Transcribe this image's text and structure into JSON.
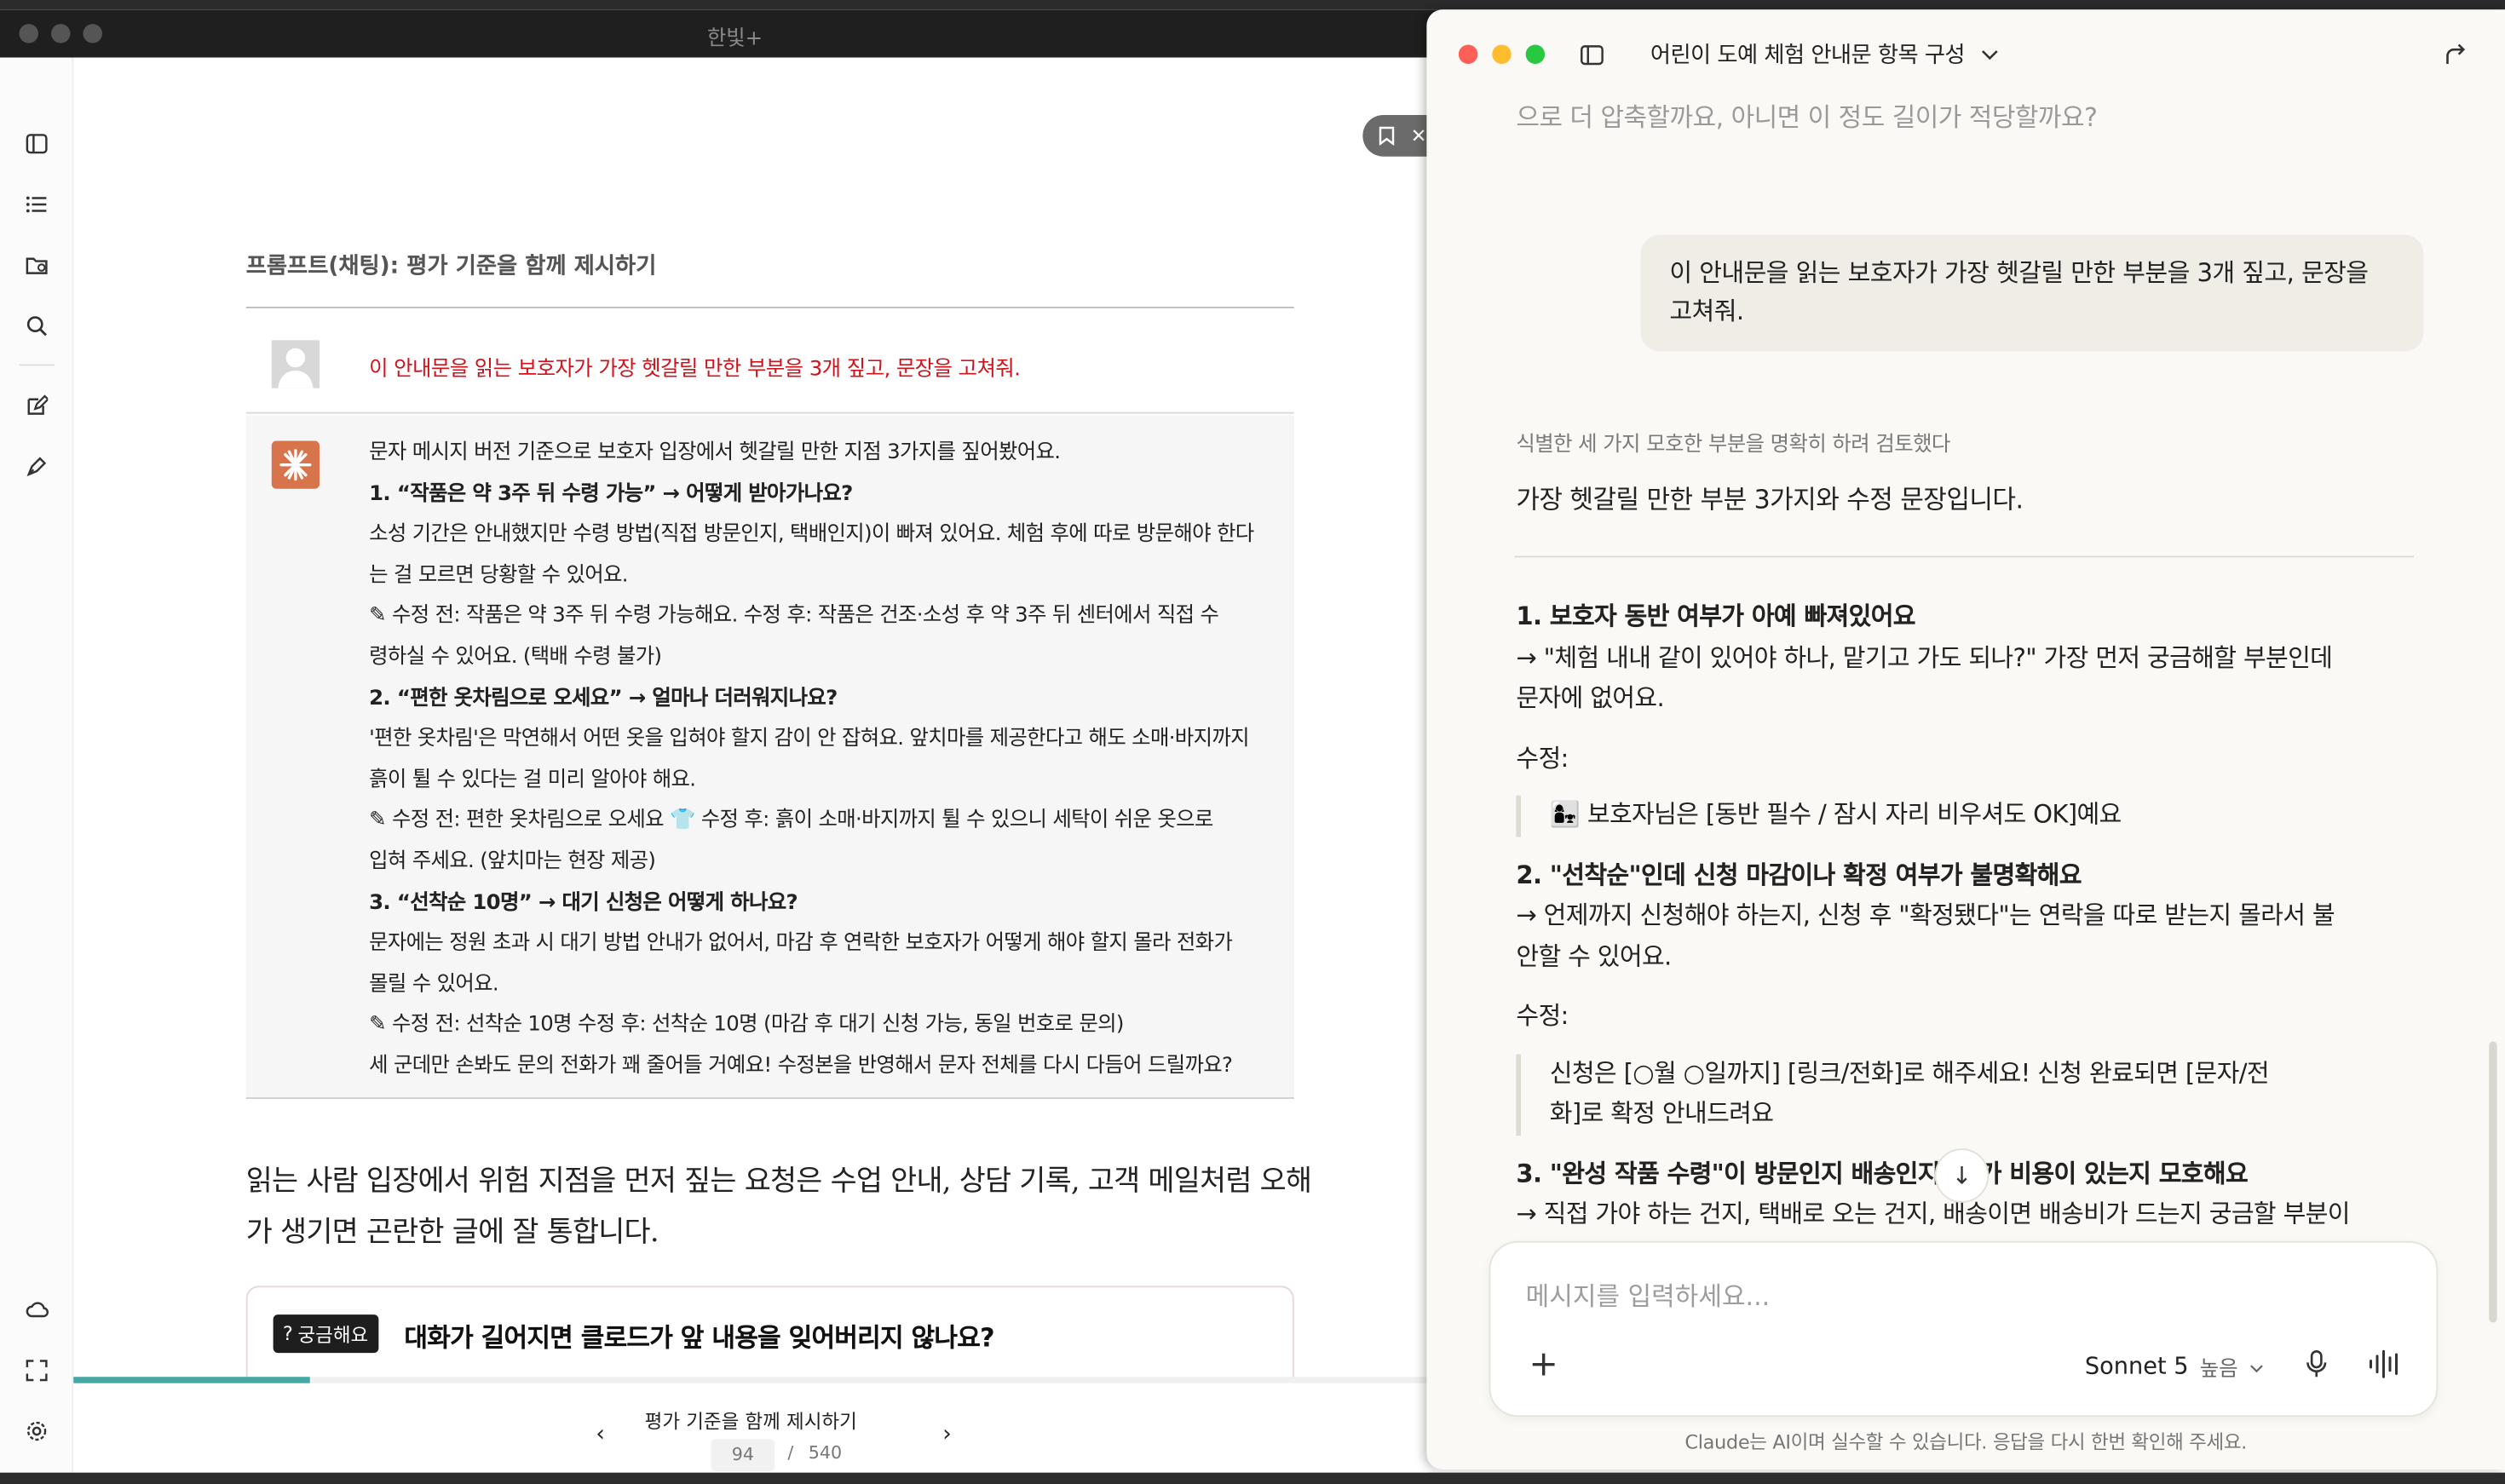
{
  "reader": {
    "app_title": "한빛+",
    "section_label": "프롬프트(채팅): 평가 기준을 함께 제시하기",
    "prompt_text": "이 안내문을 읽는 보호자가 가장 헷갈릴 만한 부분을 3개 짚고, 문장을 고쳐줘.",
    "answer_lines": [
      "문자 메시지 버전 기준으로 보호자 입장에서 헷갈릴 만한 지점 3가지를 짚어봤어요.",
      "1. “작품은 약 3주 뒤 수령 가능” → 어떻게 받아가나요?",
      "소성 기간은 안내했지만 수령 방법(직접 방문인지, 택배인지)이 빠져 있어요. 체험 후에 따로 방문해야 한다",
      "는 걸 모르면 당황할 수 있어요.",
      "✎ 수정 전: 작품은 약 3주 뒤 수령 가능해요. 수정 후: 작품은 건조·소성 후 약 3주 뒤 센터에서 직접 수",
      "령하실 수 있어요. (택배 수령 불가)",
      "2. “편한 옷차림으로 오세요” → 얼마나 더러워지나요?",
      "'편한 옷차림'은 막연해서 어떤 옷을 입혀야 할지 감이 안 잡혀요. 앞치마를 제공한다고 해도 소매·바지까지",
      "흙이 튈 수 있다는 걸 미리 알아야 해요.",
      "✎ 수정 전: 편한 옷차림으로 오세요 👕 수정 후: 흙이 소매·바지까지 튈 수 있으니 세탁이 쉬운 옷으로",
      "입혀 주세요. (앞치마는 현장 제공)",
      "3. “선착순 10명” → 대기 신청은 어떻게 하나요?",
      "문자에는 정원 초과 시 대기 방법 안내가 없어서, 마감 후 연락한 보호자가 어떻게 해야 할지 몰라 전화가",
      "몰릴 수 있어요.",
      "✎ 수정 전: 선착순 10명 수정 후: 선착순 10명 (마감 후 대기 신청 가능, 동일 번호로 문의)",
      "세 군데만 손봐도 문의 전화가 꽤 줄어들 거예요! 수정본을 반영해서 문자 전체를 다시 다듬어 드릴까요?"
    ],
    "body_lines": [
      "읽는 사람 입장에서 위험 지점을 먼저 짚는 요청은 수업 안내, 상담 기록, 고객 메일처럼 오해",
      "가 생기면 곤란한 글에 잘 통합니다."
    ],
    "faq_badge": "궁금해요",
    "faq_title": "대화가 길어지면 클로드가 앞 내용을 잊어버리지 않나요?",
    "chapter_title": "평가 기준을 함께 제시하기",
    "current_page": "94",
    "page_sep": "/",
    "total_pages": "540",
    "reading_progress": 0.174
  },
  "claude": {
    "conversation_title": "어린이 도예 체험 안내문 항목 구성",
    "faded_previous": "으로 더 압축할까요, 아니면 이 정도 길이가 적당할까요?",
    "user_message": "이 안내문을 읽는 보호자가 가장 헷갈릴 만한 부분을 3개 짚고, 문장을 고쳐줘.",
    "thinking_summary": "식별한 세 가지 모호한 부분을 명확히 하려 검토했다",
    "lead": "가장 헷갈릴 만한 부분 3가지와 수정 문장입니다.",
    "items": [
      {
        "heading": "1. 보호자 동반 여부가 아예 빠져있어요",
        "lines": [
          "→ \"체험 내내 같이 있어야 하나, 맡기고 가도 되나?\" 가장 먼저 궁금해할 부분인데",
          "문자에 없어요."
        ],
        "fix_label": "수정:",
        "fix_lines": [
          "👩‍👧 보호자님은 [동반 필수 / 잠시 자리 비우셔도 OK]예요"
        ]
      },
      {
        "heading": "2. \"선착순\"인데 신청 마감이나 확정 여부가 불명확해요",
        "lines": [
          "→ 언제까지 신청해야 하는지, 신청 후 \"확정됐다\"는 연락을 따로 받는지 몰라서 불",
          "안할 수 있어요."
        ],
        "fix_label": "수정:",
        "fix_lines": [
          "신청은 [○월 ○일까지] [링크/전화]로 해주세요! 신청 완료되면 [문자/전",
          "화]로 확정 안내드려요"
        ]
      },
      {
        "heading": "3. \"완성 작품 수령\"이 방문인지 배송인지, 추가 비용이 있는지 모호해요",
        "lines": [
          "→ 직접 가야 하는 건지, 택배로 오는 건지, 배송이면 배송비가 드는지 궁금할 부분이"
        ]
      }
    ],
    "composer_placeholder": "메시지를 입력하세요...",
    "model_name": "Sonnet 5",
    "effort": "높음",
    "disclaimer": "Claude는 AI이며 실수할 수 있습니다. 응답을 다시 한번 확인해 주세요.",
    "colors": {
      "red": "#fe5f57",
      "yellow": "#febc2e",
      "green": "#28c840",
      "accent": "#d8744c"
    }
  }
}
